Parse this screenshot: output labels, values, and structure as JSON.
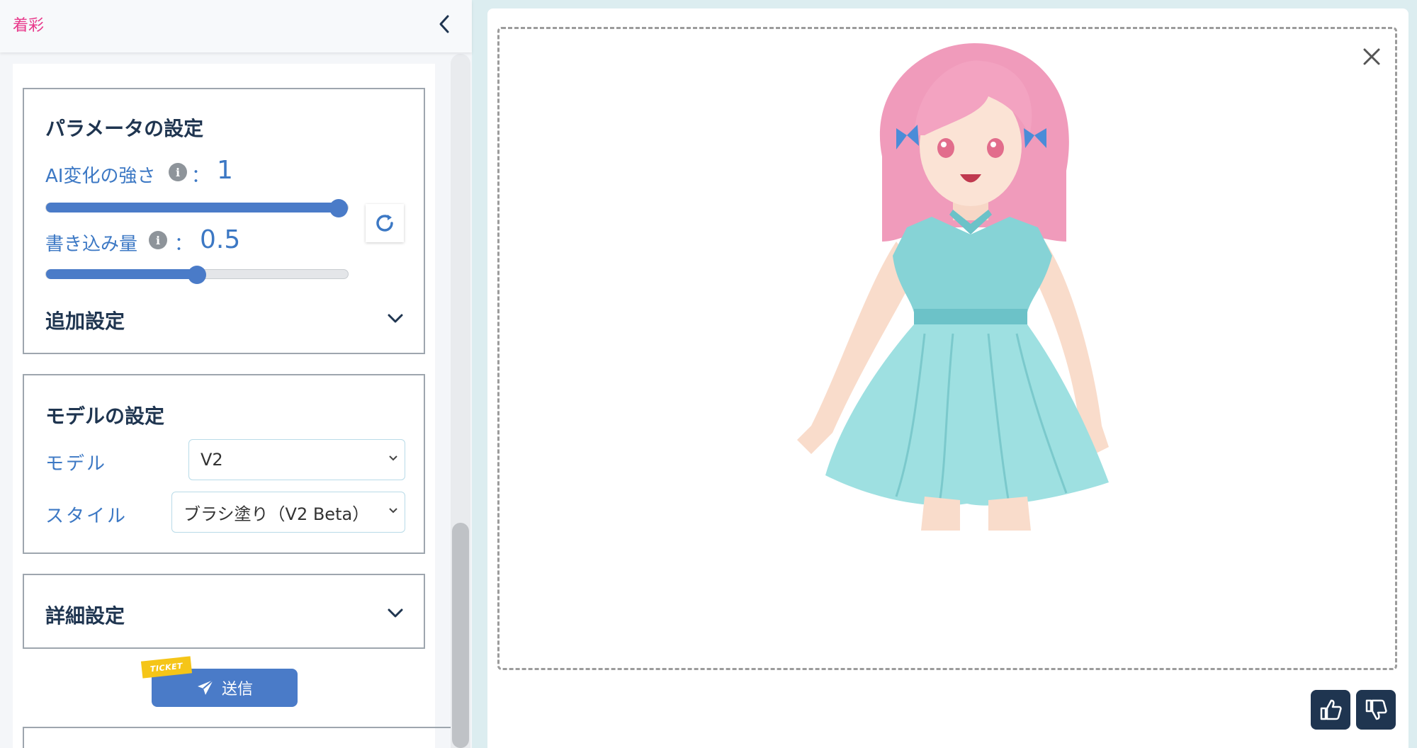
{
  "header": {
    "title": "着彩"
  },
  "params": {
    "title": "パラメータの設定",
    "strength_label": "AI変化の強さ",
    "strength_sep": "：",
    "strength_value": "1",
    "amount_label": "書き込み量",
    "amount_sep": "：",
    "amount_value": "0.5",
    "strength_level": 1.0,
    "amount_level": 0.5,
    "extra_title": "追加設定"
  },
  "model": {
    "title": "モデルの設定",
    "model_label": "モデル",
    "model_value": "V2",
    "style_label": "スタイル",
    "style_value": "ブラシ塗り（V2 Beta）"
  },
  "details": {
    "title": "詳細設定"
  },
  "submit": {
    "label": "送信",
    "ticket": "TICKET"
  },
  "colors": {
    "accent": "#4a7bc8",
    "brand_pink": "#e8388a",
    "dark": "#1f3550"
  },
  "icons": [
    "chevron-left-icon",
    "info-icon",
    "refresh-icon",
    "chevron-down-icon",
    "send-icon",
    "close-icon",
    "thumbs-up-icon",
    "thumbs-down-icon"
  ]
}
